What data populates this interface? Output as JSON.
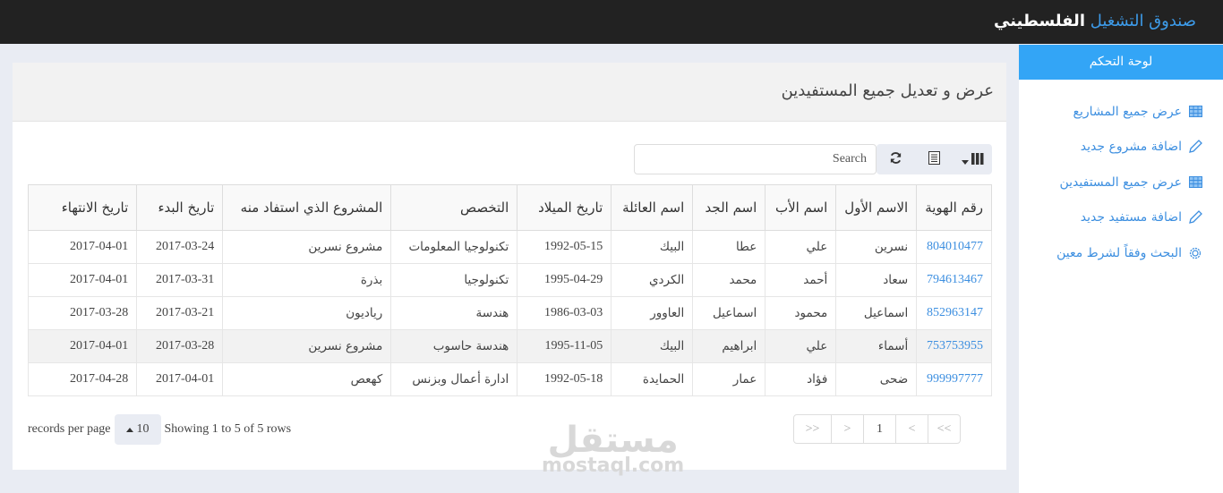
{
  "topbar": {
    "brand_part1": "صندوق التشغيل",
    "brand_part2": "الفلسطيني"
  },
  "sidebar": {
    "header": "لوحة التحكم",
    "items": [
      {
        "label": "عرض جميع المشاريع",
        "icon": "table-icon"
      },
      {
        "label": "اضافة مشروع جديد",
        "icon": "pencil-icon"
      },
      {
        "label": "عرض جميع المستفيدين",
        "icon": "table-icon"
      },
      {
        "label": "اضافة مستفيد جديد",
        "icon": "pencil-icon"
      },
      {
        "label": "البحث وفقاً لشرط معين",
        "icon": "gear-icon"
      }
    ]
  },
  "panel": {
    "title": "عرض و تعديل جميع المستفيدين"
  },
  "toolbar": {
    "search_placeholder": "Search",
    "refresh_icon": "refresh-icon",
    "toggle_icon": "list-icon",
    "columns_icon": "columns-icon"
  },
  "table": {
    "headers": [
      "رقم الهوية",
      "الاسم الأول",
      "اسم الأب",
      "اسم الجد",
      "اسم العائلة",
      "تاريخ الميلاد",
      "التخصص",
      "المشروع الذي استفاد منه",
      "تاريخ البدء",
      "تاريخ الانتهاء"
    ],
    "rows": [
      [
        "804010477",
        "نسرين",
        "علي",
        "عطا",
        "البيك",
        "1992-05-15",
        "تكنولوجيا المعلومات",
        "مشروع نسرين",
        "2017-03-24",
        "2017-04-01"
      ],
      [
        "794613467",
        "سعاد",
        "أحمد",
        "محمد",
        "الكردي",
        "1995-04-29",
        "تكنولوجيا",
        "بذرة",
        "2017-03-31",
        "2017-04-01"
      ],
      [
        "852963147",
        "اسماعيل",
        "محمود",
        "اسماعيل",
        "العاوور",
        "1986-03-03",
        "هندسة",
        "رياديون",
        "2017-03-21",
        "2017-03-28"
      ],
      [
        "753753955",
        "أسماء",
        "علي",
        "ابراهيم",
        "البيك",
        "1995-11-05",
        "هندسة حاسوب",
        "مشروع نسرين",
        "2017-03-28",
        "2017-04-01"
      ],
      [
        "999997777",
        "ضحى",
        "فؤاد",
        "عمار",
        "الحمايدة",
        "1992-05-18",
        "ادارة أعمال وبزنس",
        "كهعص",
        "2017-04-01",
        "2017-04-28"
      ]
    ]
  },
  "footer": {
    "records_per_page": "records per page",
    "page_size": "10",
    "showing": "Showing 1 to 5 of 5 rows",
    "pagination": [
      ">>",
      ">",
      "1",
      "<",
      "<<"
    ],
    "current_page": "1"
  },
  "watermark": {
    "arabic": "مستقل",
    "latin": "mostaql.com"
  }
}
